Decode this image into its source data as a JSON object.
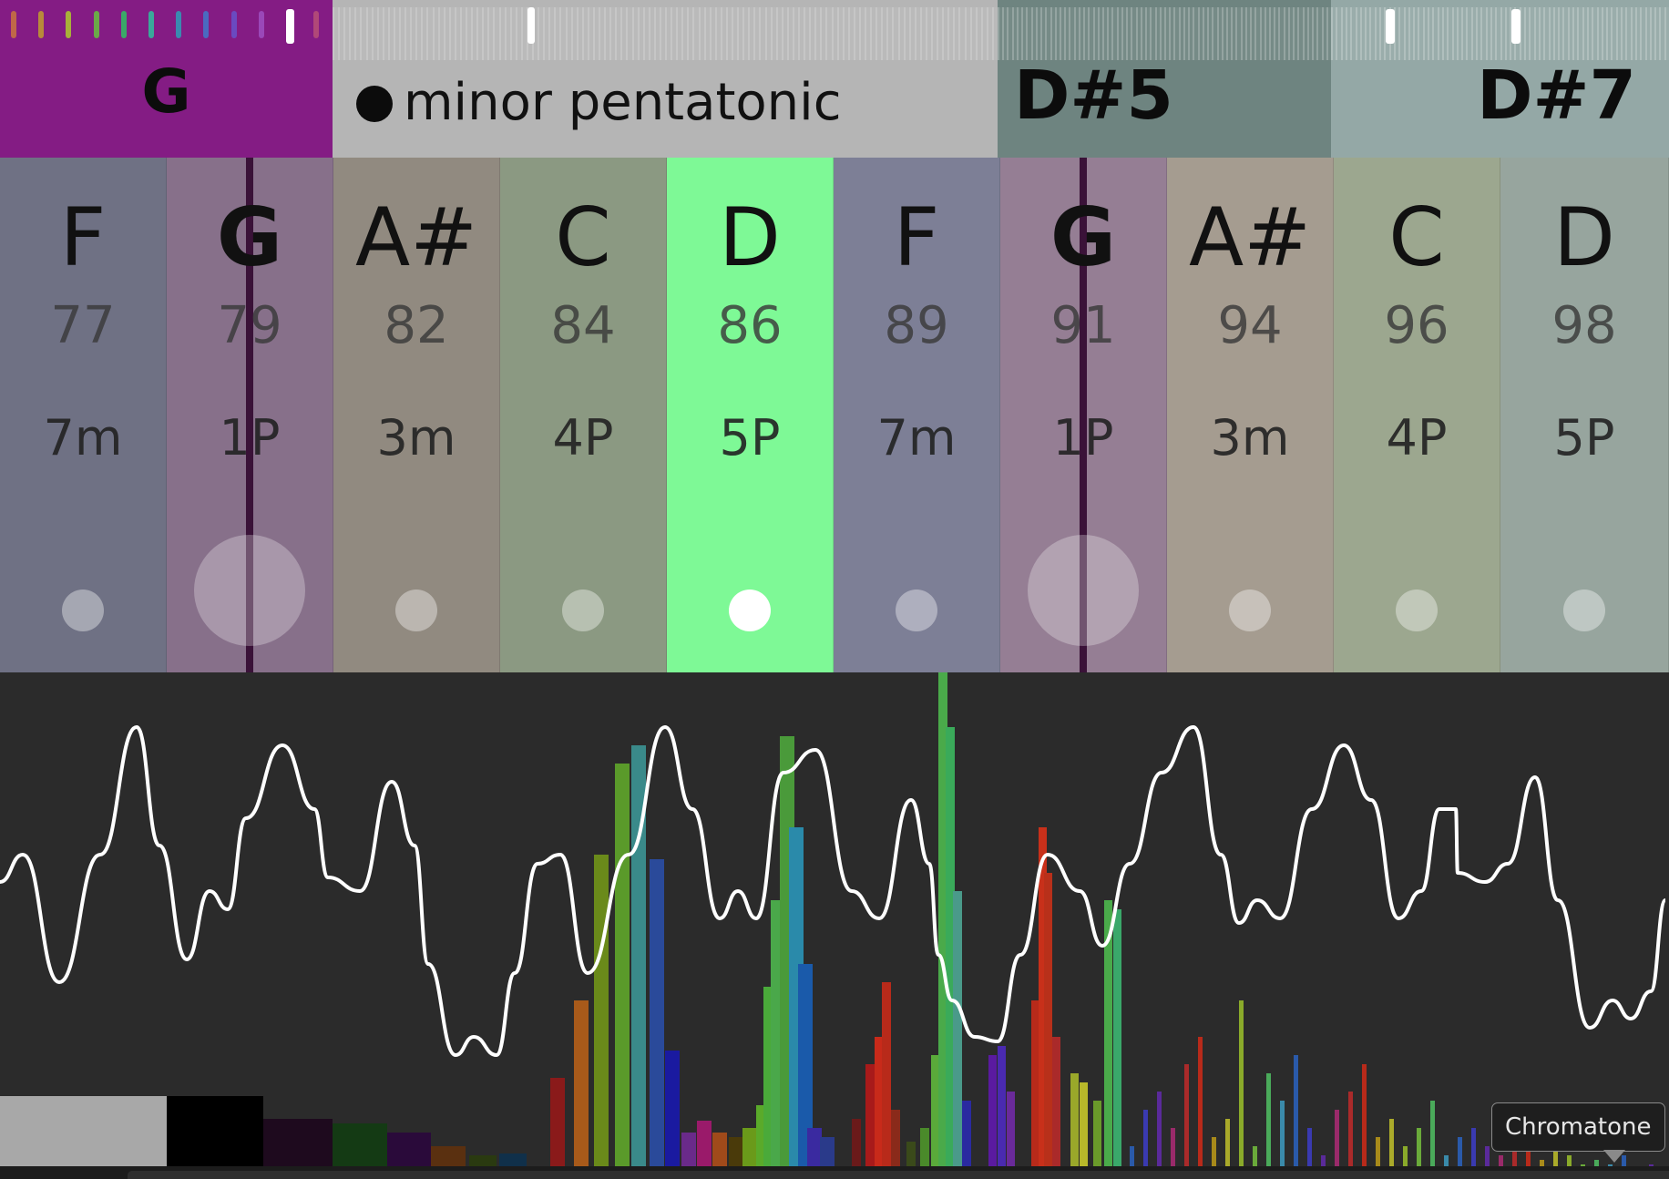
{
  "top_strip": {
    "key": {
      "label": "G",
      "color": "#841c84"
    },
    "scale": {
      "label": "minor pentatonic",
      "icon": "filled-circle-icon",
      "color": "#b5b5b5"
    },
    "chord1": {
      "label": "D#5",
      "color": "#6e8480"
    },
    "chord2": {
      "label": "D#7",
      "color": "#94a8a6"
    }
  },
  "notes": [
    {
      "name": "F",
      "midi": "77",
      "interval": "7m",
      "color": "#6f7184"
    },
    {
      "name": "G",
      "midi": "79",
      "interval": "1P",
      "color": "#87708a",
      "root": true
    },
    {
      "name": "A#",
      "midi": "82",
      "interval": "3m",
      "color": "#918a80"
    },
    {
      "name": "C",
      "midi": "84",
      "interval": "4P",
      "color": "#8b9982"
    },
    {
      "name": "D",
      "midi": "86",
      "interval": "5P",
      "color": "#7ef996",
      "active": true
    },
    {
      "name": "F",
      "midi": "89",
      "interval": "7m",
      "color": "#7d7f96"
    },
    {
      "name": "G",
      "midi": "91",
      "interval": "1P",
      "color": "#957e94",
      "root": true
    },
    {
      "name": "A#",
      "midi": "94",
      "interval": "3m",
      "color": "#a59c90"
    },
    {
      "name": "C",
      "midi": "96",
      "interval": "4P",
      "color": "#9ca78f"
    },
    {
      "name": "D",
      "midi": "98",
      "interval": "5P",
      "color": "#97a59e"
    }
  ],
  "spectrum": {
    "background": "#2b2b2b",
    "waveform_color": "#ffffff"
  },
  "tooltip": {
    "label": "Chromatone"
  }
}
